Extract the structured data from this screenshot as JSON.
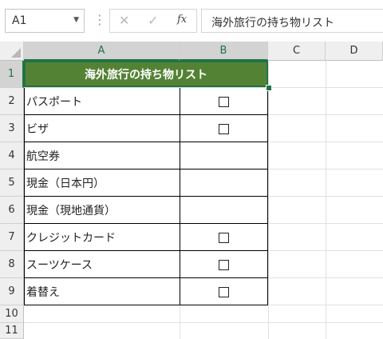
{
  "formula_bar": {
    "name_box": "A1",
    "cancel_glyph": "✕",
    "enter_glyph": "✓",
    "fx_glyph": "fx",
    "formula": "海外旅行の持ち物リスト"
  },
  "columns": [
    "A",
    "B",
    "C",
    "D"
  ],
  "rows": [
    "1",
    "2",
    "3",
    "4",
    "5",
    "6",
    "7",
    "8",
    "9",
    "10",
    "11"
  ],
  "sheet": {
    "title": "海外旅行の持ち物リスト",
    "title_fill": "#548235",
    "items": [
      {
        "name": "パスポート",
        "checkbox": true
      },
      {
        "name": "ビザ",
        "checkbox": true
      },
      {
        "name": "航空券",
        "checkbox": false
      },
      {
        "name": "現金（日本円）",
        "checkbox": false
      },
      {
        "name": "現金（現地通貨）",
        "checkbox": false
      },
      {
        "name": "クレジットカード",
        "checkbox": true
      },
      {
        "name": "スーツケース",
        "checkbox": true
      },
      {
        "name": "着替え",
        "checkbox": true
      }
    ]
  },
  "colors": {
    "accent": "#217346"
  }
}
